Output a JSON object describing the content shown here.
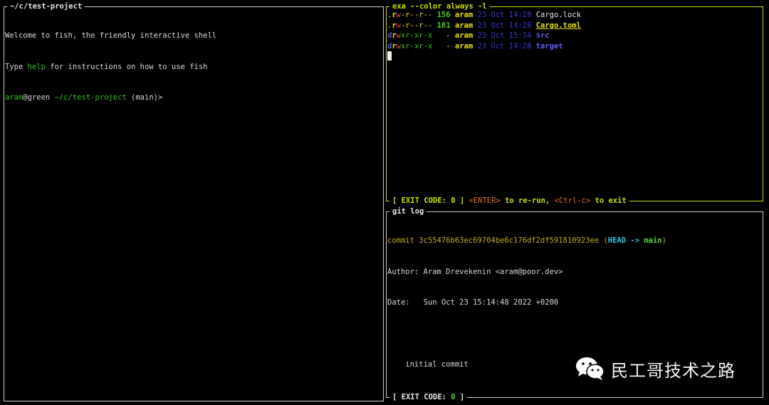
{
  "left_pane": {
    "title": "~/c/test-project",
    "welcome": "Welcome to fish, the friendly interactive shell",
    "type_prefix": "Type ",
    "help_word": "help",
    "type_suffix": " for instructions on how to use fish",
    "prompt_user": "aram",
    "prompt_at": "@green ",
    "prompt_path": "~/c/test-project",
    "prompt_branch": " (main)>"
  },
  "top_pane": {
    "title": "exa --color always -l",
    "rows": [
      {
        "d": ".",
        "r": "r",
        "w": "w",
        "rest": "-r--r--",
        "size": "156",
        "user": "aram",
        "date": "23 Oct 14:28",
        "name": "Cargo.lock",
        "style": "plain"
      },
      {
        "d": ".",
        "r": "r",
        "w": "w",
        "rest": "-r--r--",
        "size": "181",
        "user": "aram",
        "date": "23 Oct 14:28",
        "name": "Cargo.toml",
        "style": "underline"
      },
      {
        "d": "d",
        "r": "r",
        "w": "w",
        "rest": "xr-xr-x",
        "size": "-",
        "user": "aram",
        "date": "23 Oct 15:14",
        "name": "src",
        "style": "dir"
      },
      {
        "d": "d",
        "r": "r",
        "w": "w",
        "rest": "xr-xr-x",
        "size": "-",
        "user": "aram",
        "date": "23 Oct 14:28",
        "name": "target",
        "style": "dir"
      }
    ],
    "footer_open": "[ EXIT CODE: ",
    "footer_code": "0",
    "footer_close": " ] ",
    "footer_enter": "<ENTER>",
    "footer_rerun": " to re-run, ",
    "footer_ctrl": "<Ctrl-c>",
    "footer_exit": " to exit"
  },
  "bottom_pane": {
    "title": "git log",
    "commit_label": "commit 3c55476b63ec69704be6c176df2df591810923ee ",
    "paren_open": "(",
    "head": "HEAD -> ",
    "branch": "main",
    "paren_close": ")",
    "author": "Author: Aram Drevekenin <aram@poor.dev>",
    "date": "Date:   Sun Oct 23 15:14:48 2022 +0200",
    "message": "    initial commit",
    "footer_open": "[ EXIT CODE: ",
    "footer_code": "0",
    "footer_close": " ]"
  },
  "watermark": {
    "text": "民工哥技术之路",
    "icon": "wechat-icon"
  }
}
